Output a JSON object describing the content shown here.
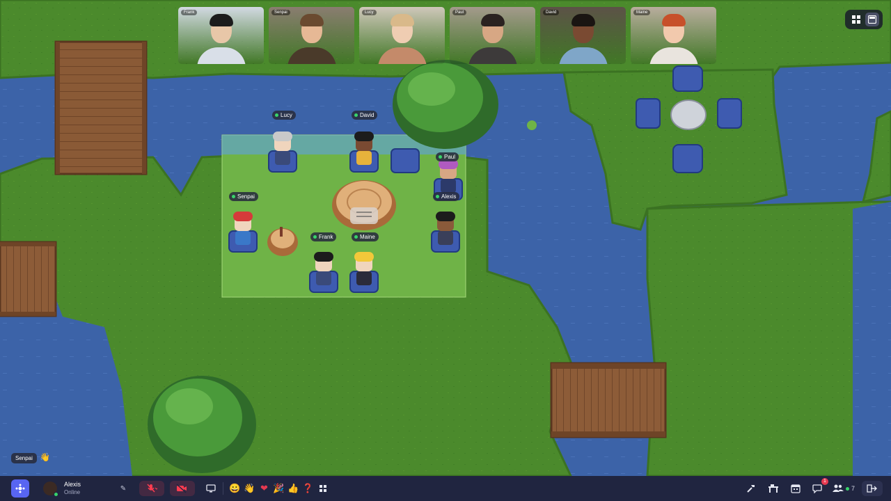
{
  "video_tiles": [
    {
      "label": "Frank",
      "skin": "#e8c7a8",
      "hair": "#1c1c1c",
      "shirt": "#d9dfe8",
      "bg": "#d2d9e2"
    },
    {
      "label": "Senpai",
      "skin": "#e6b895",
      "hair": "#6a4a30",
      "shirt": "#4a3a2a",
      "bg": "#8a7d70"
    },
    {
      "label": "Lucy",
      "skin": "#efcdb2",
      "hair": "#d9b98a",
      "shirt": "#c48a6a",
      "bg": "#cfc7ba"
    },
    {
      "label": "Paul",
      "skin": "#d7a784",
      "hair": "#2a2220",
      "shirt": "#3d3a3a",
      "bg": "#a49a8c"
    },
    {
      "label": "David",
      "skin": "#7a4a32",
      "hair": "#1a1512",
      "shirt": "#7fa6c8",
      "bg": "#5c5247"
    },
    {
      "label": "Maine",
      "skin": "#f2c9ad",
      "hair": "#c7502a",
      "shirt": "#e9e4de",
      "bg": "#b9ad9e"
    }
  ],
  "map_players": [
    {
      "name": "Lucy",
      "hair": "#c9c9c9",
      "shirt": "#3a4a7a",
      "skin": "#f0d5bd"
    },
    {
      "name": "David",
      "hair": "#1c1c1c",
      "shirt": "#e7b23b",
      "skin": "#7a4a32"
    },
    {
      "name": "Paul",
      "hair": "#b05ac0",
      "shirt": "#2c3a6a",
      "skin": "#d7a784"
    },
    {
      "name": "Senpai",
      "hair": "#d63a3a",
      "shirt": "#3a78c8",
      "skin": "#f0d5bd"
    },
    {
      "name": "Alexis",
      "hair": "#1c1c1c",
      "shirt": "#3a3f5a",
      "skin": "#8a5a3a"
    },
    {
      "name": "Frank",
      "hair": "#1c1c1c",
      "shirt": "#3a4a7a",
      "skin": "#f0d5bd"
    },
    {
      "name": "Maine",
      "hair": "#f2c83a",
      "shirt": "#2b2b3a",
      "skin": "#f0d5bd"
    }
  ],
  "chat": {
    "sender": "Senpai",
    "emoji": "👋"
  },
  "user": {
    "name": "Alexis",
    "status": "Online"
  },
  "toolbar": {
    "reactions": [
      "😀",
      "👋",
      "❤",
      "🎉",
      "👍",
      "❓"
    ],
    "notifications_count": "1",
    "participant_count": "7"
  },
  "colors": {
    "grass": "#4b8a2c",
    "grass_dark": "#3b7222",
    "water": "#3c63a8",
    "wood": "#8a5a36",
    "chair": "#3e5bb0",
    "toolbar_bg": "#202540",
    "online": "#38d36b",
    "muted": "#ff3c50"
  }
}
